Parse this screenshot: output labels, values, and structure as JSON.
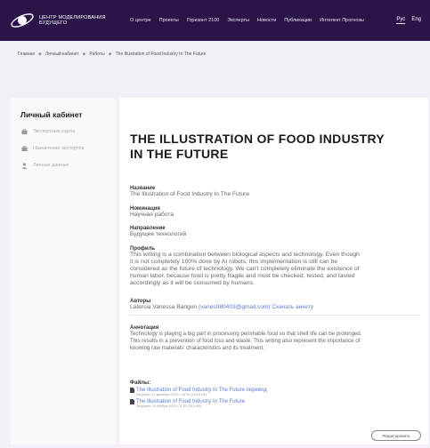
{
  "header": {
    "logo_line1": "Центр моделирования",
    "logo_line2": "будущего",
    "nav": [
      "О центре",
      "Проекты",
      "Горизонт 2100",
      "Эксперты",
      "Новости",
      "Публикации",
      "Интелект Прогнозы"
    ],
    "lang_ru": "Рус",
    "lang_en": "Eng"
  },
  "breadcrumb": {
    "home": "Главная",
    "cabinet": "Личный кабинет",
    "works": "Работы",
    "current": "The Illustration of Food Industry In The Future"
  },
  "sidebar": {
    "title": "Личный кабинет",
    "items": [
      {
        "label": "Экспертные карты",
        "icon": "briefcase-icon"
      },
      {
        "label": "Назначение экспертов",
        "icon": "briefcase-icon"
      },
      {
        "label": "Личные данные",
        "icon": "user-icon"
      }
    ]
  },
  "main": {
    "title_line1": "The Illustration of Food Industry",
    "title_line2": "In The Future",
    "name_label": "Название",
    "name_value": "The Illustration of Food Industry In The Future",
    "nomination_label": "Номинация",
    "nomination_value": "Научная работа",
    "direction_label": "Направление",
    "direction_value": "Будущее технологий",
    "profile_label": "Профиль",
    "profile_line1": "This writing is a combination between biological aspects and technology. Even though",
    "profile_line2": "it is not completely 100% done by AI robots, this implementation is still can be",
    "profile_line3": "considered as the future of technology. We can't completely eliminate the existence of",
    "profile_line4": "human labor, because food is pretty fragile and must be checked, tested, and tasted",
    "profile_line5": "accordingly as it will be consumed by humans.",
    "authors_label": "Авторы",
    "author_name": "Latersia Vanessa Bangun",
    "author_email": "(vanes080403@gmail.com)",
    "author_download": "Скачать анкету",
    "annotation_label": "Аннотация",
    "annotation_line1": "Technology is playing a big part in processing perishable food so that shelf life can be prolonged.",
    "annotation_line2": "This results in a prevention of food loss and waste. This writing also represent the importance of",
    "annotation_line3": "knowing raw materials' characteristics and its treatment.",
    "files_label": "Файлы:",
    "files": [
      {
        "name": "The Illustration of Food Industry In The Future перевод",
        "meta": "Загружен 10 декабря 2022 г. 14:33 (145,6 КБ)"
      },
      {
        "name": "The Illustration of Food Industry In The Future",
        "meta": "Загружен 29 ноября 2022 г. 6:35 (16,3 КБ)"
      }
    ],
    "edit_button": "Редактировать"
  },
  "colors": {
    "header_bg": "#2a1448",
    "page_bg": "#f4eef7",
    "link": "#5b7bd5"
  }
}
